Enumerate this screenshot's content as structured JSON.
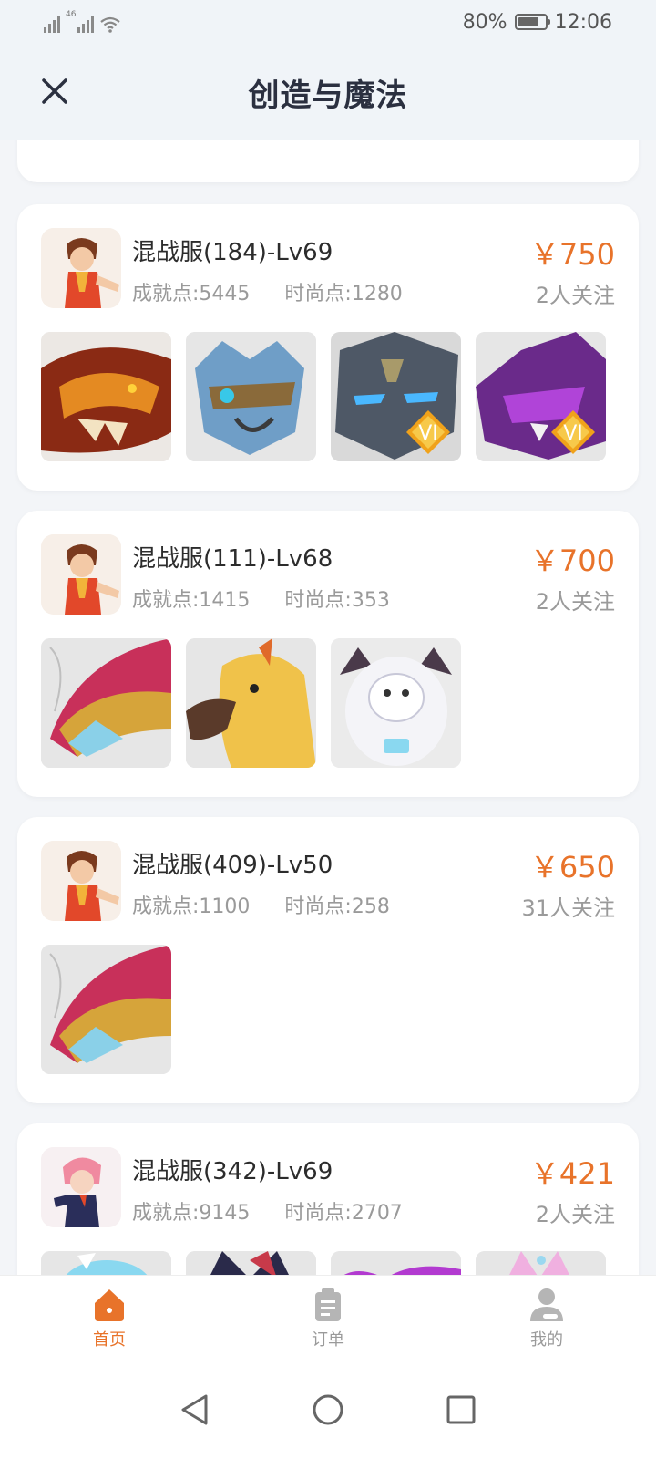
{
  "status_bar": {
    "network": "46",
    "battery": "80%",
    "time": "12:06"
  },
  "header": {
    "title": "创造与魔法"
  },
  "listings": [
    {
      "server": "混战服(184)-Lv69",
      "achievement": "成就点:5445",
      "fashion": "时尚点:1280",
      "price": "￥750",
      "followers": "2人关注",
      "thumbs": [
        "fire-dragon",
        "armored-wolf",
        "stone-golem",
        "purple-dragon"
      ]
    },
    {
      "server": "混战服(111)-Lv68",
      "achievement": "成就点:1415",
      "fashion": "时尚点:353",
      "price": "￥700",
      "followers": "2人关注",
      "thumbs": [
        "rainbow-dragon",
        "golden-bird",
        "cow-astronaut"
      ]
    },
    {
      "server": "混战服(409)-Lv50",
      "achievement": "成就点:1100",
      "fashion": "时尚点:258",
      "price": "￥650",
      "followers": "31人关注",
      "thumbs": [
        "rainbow-dragon"
      ]
    },
    {
      "server": "混战服(342)-Lv69",
      "achievement": "成就点:9145",
      "fashion": "时尚点:2707",
      "price": "￥421",
      "followers": "2人关注",
      "thumbs": [
        "ice-creature",
        "dark-dragon",
        "purple-beast",
        "pink-creature"
      ]
    }
  ],
  "badge": "VI",
  "bottom_nav": {
    "home": "首页",
    "orders": "订单",
    "mine": "我的"
  },
  "colors": {
    "accent": "#e8732a",
    "title": "#2b3040",
    "muted": "#9a9a9a"
  }
}
